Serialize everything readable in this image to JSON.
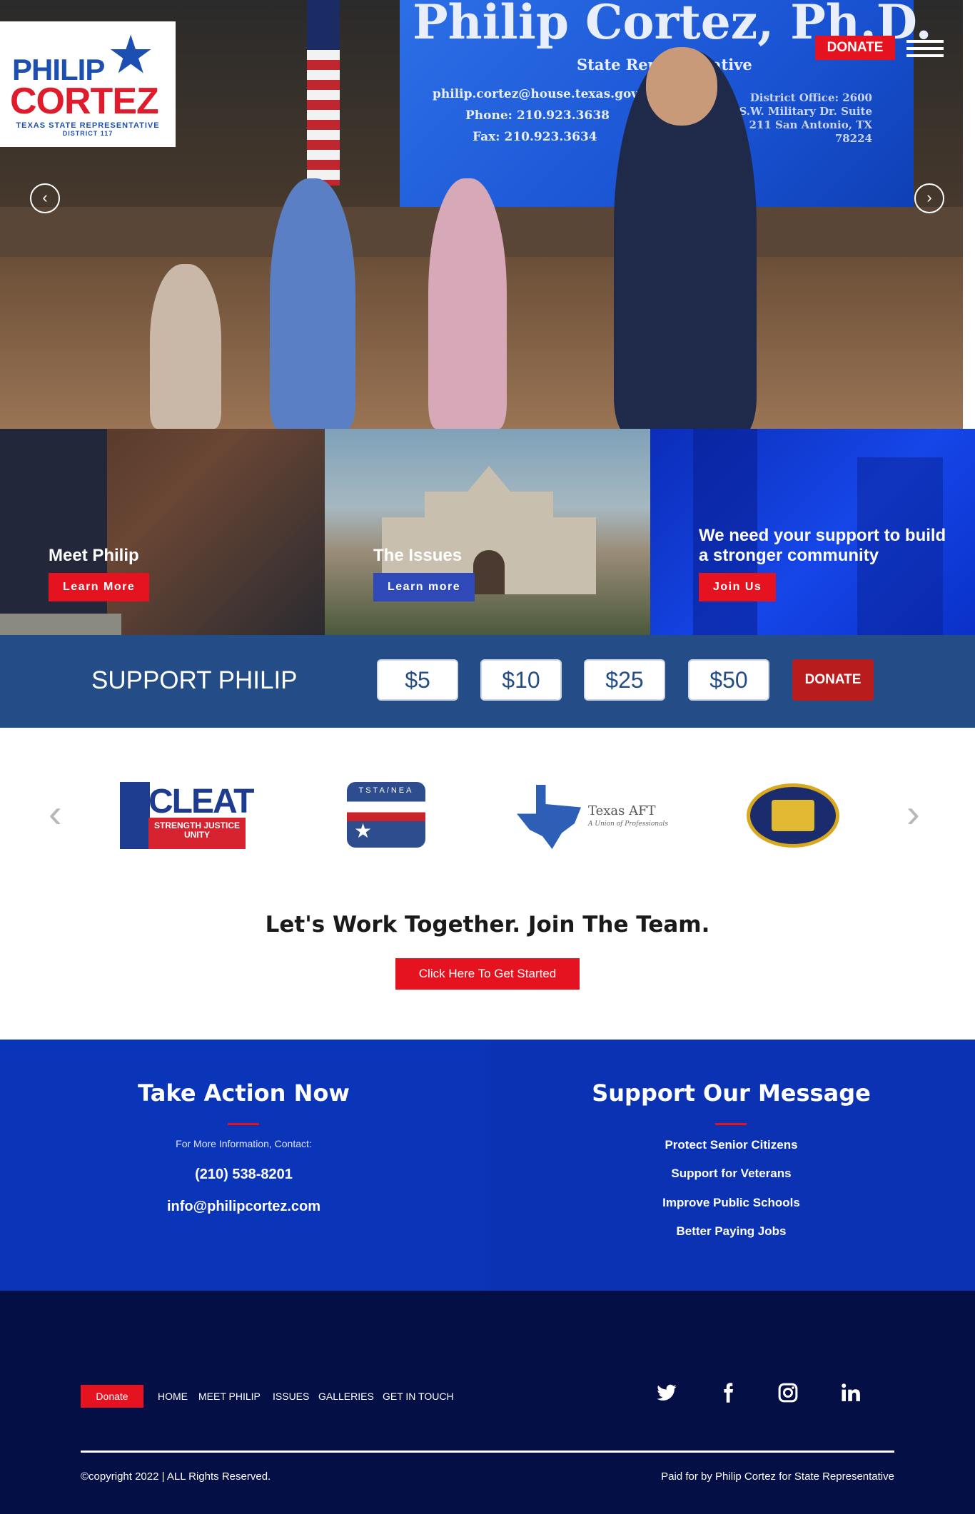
{
  "logo": {
    "line_first": "PHILIP",
    "line_last": "CORTEZ",
    "tagline": "TEXAS STATE REPRESENTATIVE",
    "district": "DISTRICT 117"
  },
  "hero": {
    "donate_label": "DONATE",
    "screen_title": "Philip Cortez, Ph.D.",
    "screen_subtitle": "State Representative",
    "screen_email": "philip.cortez@house.texas.gov",
    "screen_phone": "Phone: 210.923.3638",
    "screen_fax": "Fax: 210.923.3634",
    "screen_office": "District Office: 2600 S.W. Military Dr. Suite 211 San Antonio, TX 78224",
    "prev_label": "‹",
    "next_label": "›"
  },
  "panels": [
    {
      "title": "Meet Philip",
      "button": "Learn More"
    },
    {
      "title": "The Issues",
      "button": "Learn more"
    },
    {
      "title": "We need your support to build a stronger community",
      "button": "Join Us"
    }
  ],
  "support": {
    "title": "SUPPORT PHILIP",
    "amounts": [
      "$5",
      "$10",
      "$25",
      "$50"
    ],
    "donate_label": "DONATE"
  },
  "endorsements": {
    "cleat_name": "CLEAT",
    "cleat_motto": "STRENGTH JUSTICE UNITY",
    "tsta_name": "TSTA/NEA",
    "aft_name": "Texas AFT",
    "aft_sub": "A Union of Professionals",
    "prev_label": "‹",
    "next_label": "›"
  },
  "join": {
    "title": "Let's Work Together. Join The Team.",
    "button": "Click Here To Get Started"
  },
  "take_action": {
    "title": "Take Action Now",
    "contact_label": "For More Information, Contact:",
    "phone": "(210) 538-8201",
    "email": "info@philipcortez.com"
  },
  "message": {
    "title": "Support Our Message",
    "items": [
      "Protect Senior Citizens",
      "Support for Veterans",
      "Improve Public Schools",
      "Better Paying Jobs"
    ]
  },
  "footer": {
    "donate_label": "Donate",
    "nav": [
      "HOME",
      "MEET PHILIP",
      "ISSUES",
      "GALLERIES",
      "GET IN TOUCH"
    ],
    "social_icons": [
      "twitter-icon",
      "facebook-icon",
      "instagram-icon",
      "linkedin-icon"
    ],
    "copyright": "©copyright 2022 | ALL Rights Reserved.",
    "paid_for": "Paid for by Philip Cortez for State Representative"
  },
  "colors": {
    "accent_red": "#e5131f",
    "support_blue": "#244d88",
    "action_blue": "#0b35b9",
    "footer_navy": "#030f45"
  }
}
